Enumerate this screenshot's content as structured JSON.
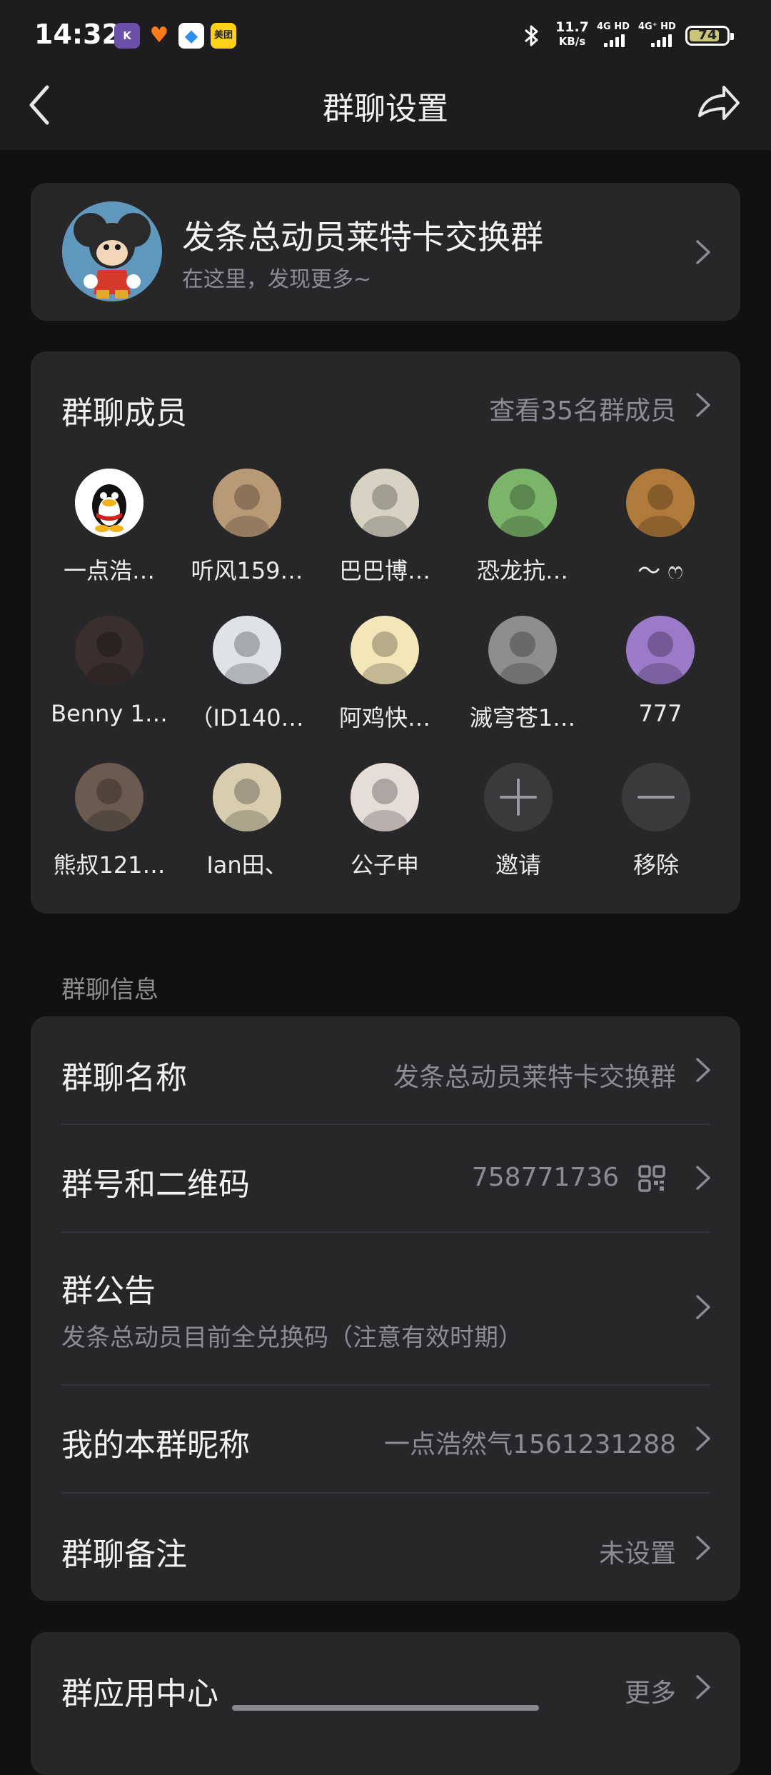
{
  "status_bar": {
    "time": "14:32",
    "speed_value": "11.7",
    "speed_unit": "KB/s",
    "sim1_label": "4G HD",
    "sim2_label": "4G⁺ HD",
    "battery": "74",
    "battery_level": 74,
    "app_icons": [
      {
        "name": "k-app-icon",
        "color": "#6b4fa8",
        "glyph": "K"
      },
      {
        "name": "heart-app-icon",
        "color": "#ff7a1a",
        "glyph": "♥"
      },
      {
        "name": "bird-app-icon",
        "color": "#2f8ff0",
        "glyph": "●"
      },
      {
        "name": "meituan-app-icon",
        "color": "#ffd21a",
        "glyph": "美团"
      }
    ]
  },
  "nav": {
    "title": "群聊设置"
  },
  "group": {
    "name": "发条总动员莱特卡交换群",
    "subtitle": "在这里，发现更多~"
  },
  "members": {
    "title": "群聊成员",
    "more_label": "查看35名群成员",
    "list": [
      {
        "name": "一点浩…",
        "color": "#ffffff"
      },
      {
        "name": "听风159…",
        "color": "#b99a77"
      },
      {
        "name": "巴巴博…",
        "color": "#d8d2c2"
      },
      {
        "name": "恐龙抗…",
        "color": "#7bb56a"
      },
      {
        "name": "～ ෆ",
        "color": "#b07a3a"
      },
      {
        "name": "Benny 1…",
        "color": "#3a2f2e"
      },
      {
        "name": "（ID140…",
        "color": "#dfe3e6"
      },
      {
        "name": "阿鸡快…",
        "color": "#f3e6b8"
      },
      {
        "name": "滅穹苍1…",
        "color": "#8d8d8d"
      },
      {
        "name": "777",
        "color": "#9b7ac9"
      },
      {
        "name": "熊叔121…",
        "color": "#6b5a50"
      },
      {
        "name": "Ian田、",
        "color": "#d9cdb0"
      },
      {
        "name": "公子申",
        "color": "#e6dcd8"
      }
    ],
    "invite_label": "邀请",
    "remove_label": "移除"
  },
  "info": {
    "section_label": "群聊信息",
    "name_label": "群聊名称",
    "name_value": "发条总动员莱特卡交换群",
    "number_label": "群号和二维码",
    "number_value": "758771736",
    "notice_label": "群公告",
    "notice_value": "发条总动员目前全兑换码（注意有效时期）",
    "nickname_label": "我的本群昵称",
    "nickname_value": "一点浩然气1561231288",
    "remark_label": "群聊备注",
    "remark_value": "未设置"
  },
  "apps": {
    "label": "群应用中心",
    "more": "更多"
  }
}
